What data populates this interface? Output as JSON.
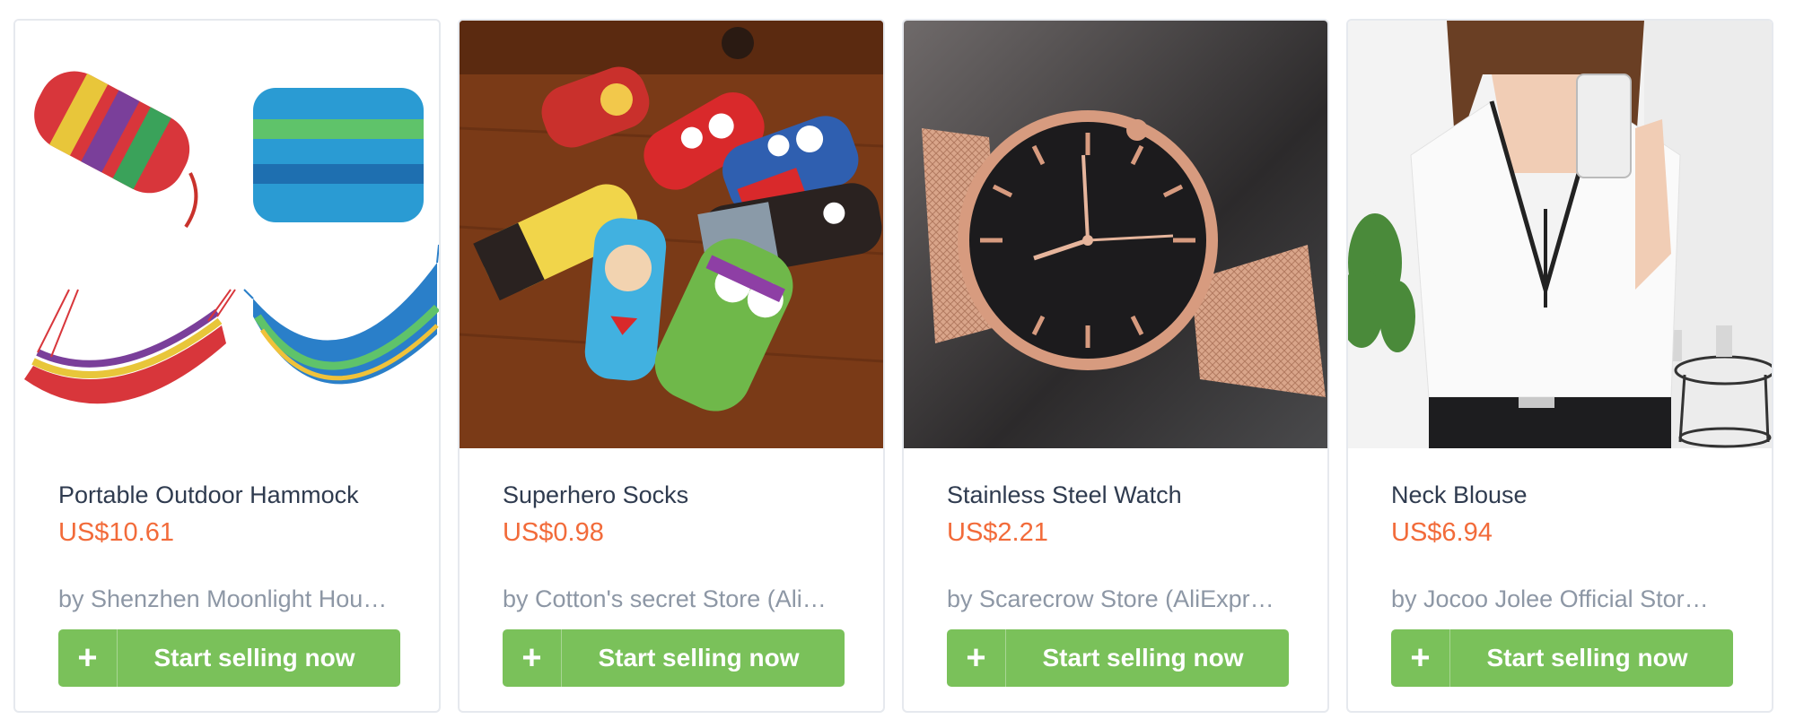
{
  "colors": {
    "accent_button": "#7ac15a",
    "price": "#f26b3a",
    "title": "#2f3b4f",
    "seller": "#8d97a5"
  },
  "products": [
    {
      "image_alt": "hammock product photo",
      "title": "Portable Outdoor Hammock",
      "price": "US$10.61",
      "seller": "by Shenzhen Moonlight Hou…",
      "button_icon": "plus-icon",
      "button_label": "Start selling now"
    },
    {
      "image_alt": "superhero socks product photo",
      "title": "Superhero Socks",
      "price": "US$0.98",
      "seller": "by Cotton's secret Store (Ali…",
      "button_icon": "plus-icon",
      "button_label": "Start selling now"
    },
    {
      "image_alt": "watch product photo",
      "title": "Stainless Steel Watch",
      "price": "US$2.21",
      "seller": "by Scarecrow Store (AliExpr…",
      "button_icon": "plus-icon",
      "button_label": "Start selling now"
    },
    {
      "image_alt": "blouse product photo",
      "title": "Neck Blouse",
      "price": "US$6.94",
      "seller": "by Jocoo Jolee Official Stor…",
      "button_icon": "plus-icon",
      "button_label": "Start selling now"
    }
  ]
}
